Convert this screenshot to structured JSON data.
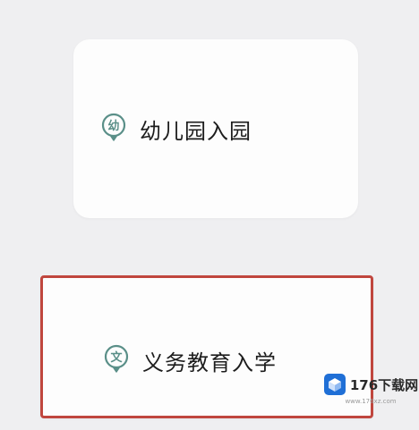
{
  "cards": [
    {
      "label": "幼儿园入园",
      "icon_char": "幼",
      "icon": "kindergarten-pin-icon",
      "selected": false
    },
    {
      "label": "义务教育入学",
      "icon_char": "文",
      "icon": "compulsory-education-pin-icon",
      "selected": true
    }
  ],
  "watermark": {
    "brand": "176下载网",
    "url": "www.176xz.com"
  },
  "colors": {
    "background": "#efeff1",
    "card": "#fdfdfd",
    "selected_border": "#c0463e",
    "icon_teal": "#5a8f88",
    "text": "#1d1d1d"
  }
}
